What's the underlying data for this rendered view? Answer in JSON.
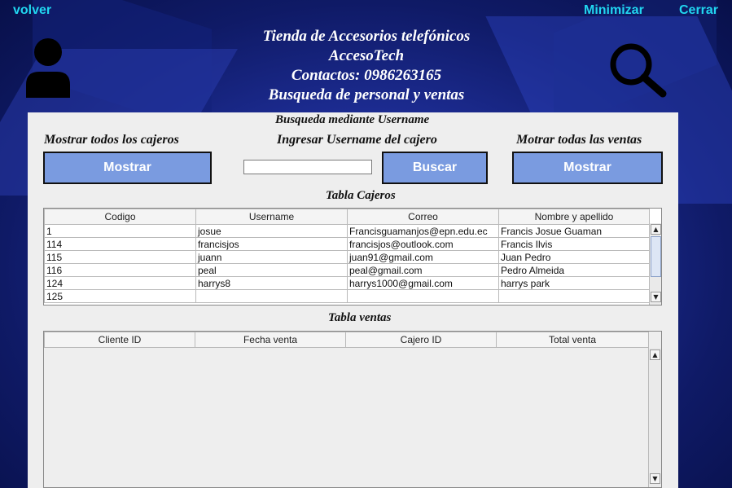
{
  "topbar": {
    "back": "volver",
    "minimize": "Minimizar",
    "close": "Cerrar"
  },
  "header": {
    "line1": "Tienda de Accesorios telefónicos",
    "line2": "AccesoTech",
    "line3": "Contactos: 0986263165",
    "line4": "Busqueda de personal y ventas"
  },
  "icons": {
    "user": "user-icon",
    "search": "magnifier-icon"
  },
  "colors": {
    "accent": "#21d6f0",
    "button": "#7a9be0",
    "panel": "#eeeeee"
  },
  "search": {
    "section_title": "Busqueda mediante Username",
    "show_all_cashiers_label": "Mostrar todos los cajeros",
    "enter_username_label": "Ingresar Username del cajero",
    "show_all_sales_label": "Motrar todas las ventas",
    "show_cashiers_button": "Mostrar",
    "search_button": "Buscar",
    "show_sales_button": "Mostrar",
    "username_value": ""
  },
  "cashiers": {
    "title": "Tabla Cajeros",
    "columns": [
      "Codigo",
      "Username",
      "Correo",
      "Nombre y apellido"
    ],
    "rows": [
      [
        "1",
        "josue",
        "Francisguamanjos@epn.edu.ec",
        "Francis Josue Guaman"
      ],
      [
        "114",
        "francisjos",
        "francisjos@outlook.com",
        "Francis Ilvis"
      ],
      [
        "115",
        "juann",
        "juan91@gmail.com",
        "Juan Pedro"
      ],
      [
        "116",
        "peal",
        "peal@gmail.com",
        "Pedro Almeida"
      ],
      [
        "124",
        "harrys8",
        "harrys1000@gmail.com",
        "harrys park"
      ],
      [
        "125",
        "",
        "",
        ""
      ]
    ]
  },
  "sales": {
    "title": "Tabla ventas",
    "columns": [
      "Cliente ID",
      "Fecha venta",
      "Cajero ID",
      "Total venta"
    ]
  }
}
